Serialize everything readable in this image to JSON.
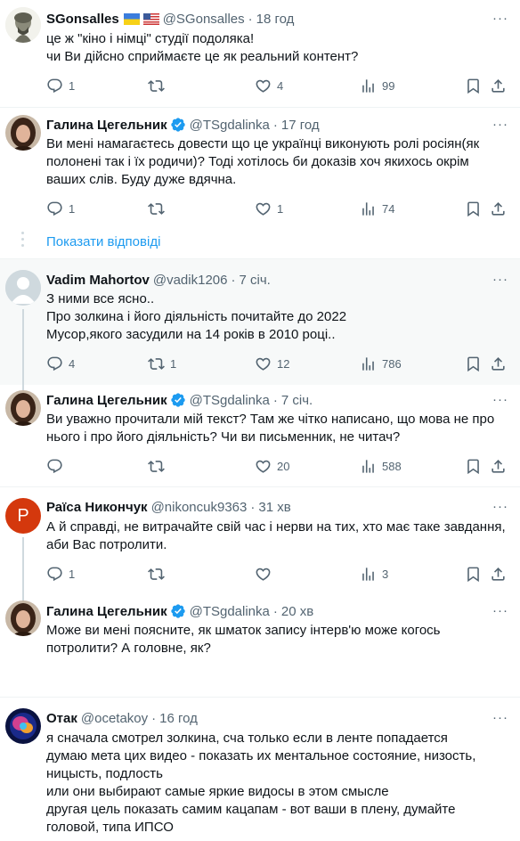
{
  "tweets": [
    {
      "name": "SGonsalles",
      "handle": "@SGonsalles",
      "time": "18 год",
      "lines": [
        "це ж \"кіно і німці\" студії подоляка!",
        "чи Ви дійсно сприймаєте це як реальний контент?"
      ],
      "replies": "1",
      "retweets": "",
      "likes": "4",
      "views": "99"
    },
    {
      "name": "Галина Цегельник",
      "handle": "@TSgdalinka",
      "time": "17 год",
      "lines": [
        "Ви мені намагаєтесь довести що це українці виконують ролі росіян(як",
        "полонені так і їх родичи)? Тоді хотілось би доказів хоч якихось окрім",
        "ваших слів. Буду дуже вдячна."
      ],
      "replies": "1",
      "retweets": "",
      "likes": "1",
      "views": "74"
    },
    {
      "name": "Vadim Mahortov",
      "handle": "@vadik1206",
      "time": "7 січ.",
      "lines": [
        "З ними все ясно..",
        "Про золкина і його діяльність почитайте до 2022",
        "Мусор,якого засудили на 14 років в 2010 році.."
      ],
      "replies": "4",
      "retweets": "1",
      "likes": "12",
      "views": "786"
    },
    {
      "name": "Галина Цегельник",
      "handle": "@TSgdalinka",
      "time": "7 січ.",
      "lines": [
        "Ви уважно прочитали мій текст? Там же чітко написано, що мова не про",
        "нього і про його діяльність? Чи ви письменник, не читач?"
      ],
      "replies": "",
      "retweets": "",
      "likes": "20",
      "views": "588"
    },
    {
      "name": "Раїса Никончук",
      "handle": "@nikoncuk9363",
      "time": "31 хв",
      "avatar_letter": "P",
      "lines": [
        "А й справді, не витрачайте свій час і нерви на тих, хто має таке завдання,",
        "аби Вас потролити."
      ],
      "replies": "1",
      "retweets": "",
      "likes": "",
      "views": "3"
    },
    {
      "name": "Галина Цегельник",
      "handle": "@TSgdalinka",
      "time": "20 хв",
      "lines": [
        "Може ви мені поясните, як шматок запису інтерв'ю може когось",
        "потролити? А головне, як?"
      ]
    },
    {
      "name": "Отак",
      "handle": "@ocetakoy",
      "time": "16 год",
      "lines": [
        "я сначала смотрел золкина, сча только если в ленте попадается",
        "думаю мета цих видео - показать их ментальное состояние, низость,",
        "ницысть, подлость",
        "или они выбирают самые яркие видосы в этом смысле",
        "другая цель показать самим кацапам - вот ваши в плену, думайте",
        "головой, типа ИПСО"
      ]
    }
  ],
  "show_replies_label": "Показати відповіді",
  "more_label": "···",
  "dot": "·",
  "colors": {
    "accent": "#1d9bf0",
    "muted": "#536471",
    "verified": "#1d9bf0",
    "avatar_p": "#d4380d"
  },
  "icons": [
    "reply-icon",
    "retweet-icon",
    "like-icon",
    "views-icon",
    "bookmark-icon",
    "share-icon",
    "verified-badge-icon",
    "ukraine-flag-icon",
    "usa-flag-icon"
  ]
}
